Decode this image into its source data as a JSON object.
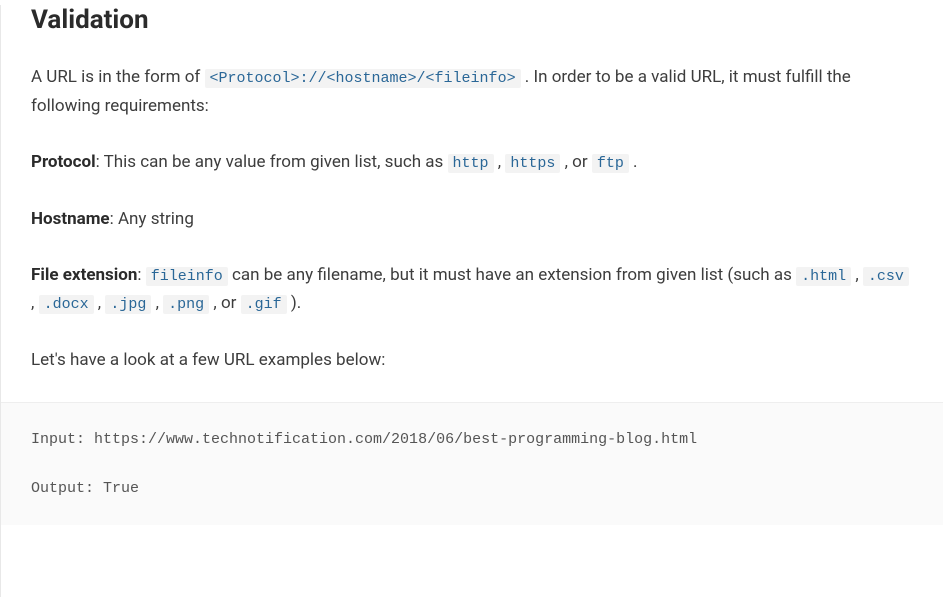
{
  "heading": "Validation",
  "intro_prefix": "A URL is in the form of ",
  "intro_code": "<Protocol>://<hostname>/<fileinfo>",
  "intro_suffix": " . In order to be a valid URL, it must fulfill the following requirements:",
  "protocol_label": "Protocol",
  "protocol_text_1": ": This can be any value from given list, such as ",
  "protocol_code_http": "http",
  "protocol_sep_1": " , ",
  "protocol_code_https": "https",
  "protocol_sep_2": " , or ",
  "protocol_code_ftp": "ftp",
  "protocol_end": " .",
  "hostname_label": "Hostname",
  "hostname_text": ": Any string",
  "fileext_label": "File extension",
  "fileext_text_1": ": ",
  "fileext_code_fileinfo": "fileinfo",
  "fileext_text_2": " can be any filename, but it must have an extension from given list (such as ",
  "fileext_code_html": ".html",
  "fileext_sep_1": " , ",
  "fileext_code_csv": ".csv",
  "fileext_sep_2": " , ",
  "fileext_code_docx": ".docx",
  "fileext_sep_3": " , ",
  "fileext_code_jpg": ".jpg",
  "fileext_sep_4": " , ",
  "fileext_code_png": ".png",
  "fileext_sep_5": " , or ",
  "fileext_code_gif": ".gif",
  "fileext_end": " ).",
  "examples_intro": "Let's have a look at a few URL examples below:",
  "example_input": "Input: https://www.technotification.com/2018/06/best-programming-blog.html",
  "example_output": "Output: True"
}
